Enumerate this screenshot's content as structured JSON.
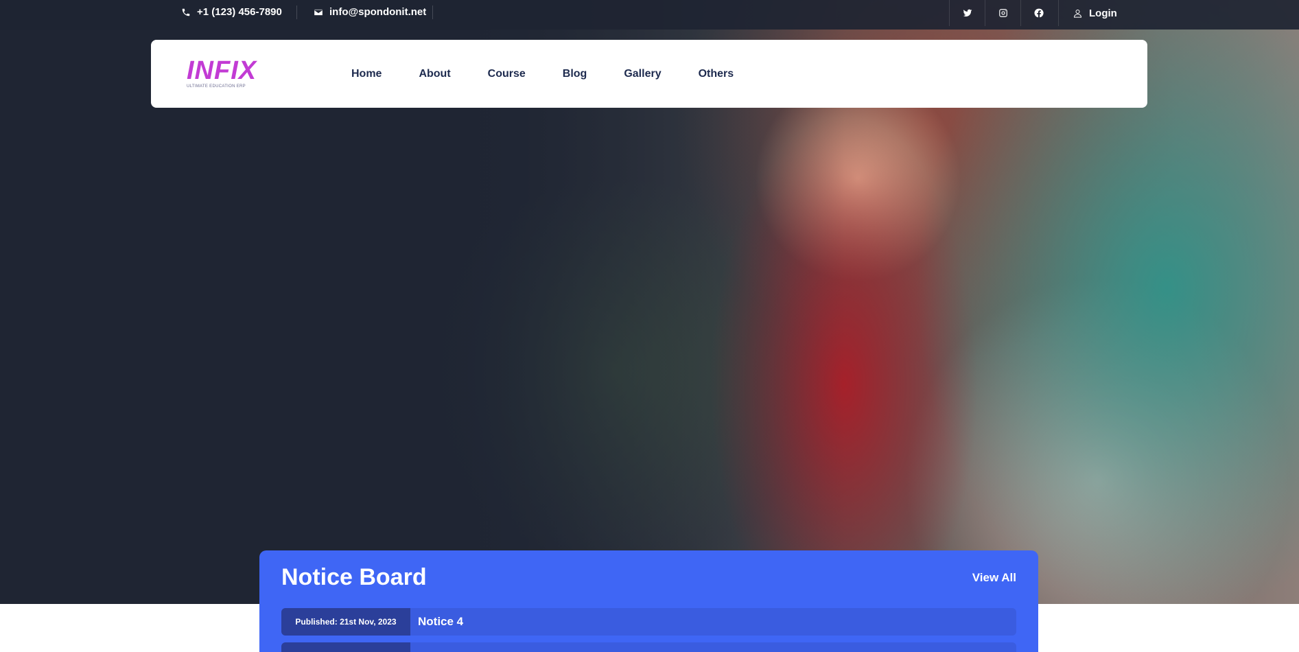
{
  "topbar": {
    "phone": "+1 (123) 456-7890",
    "email": "info@spondonit.net",
    "social": [
      "twitter-icon",
      "instagram-icon",
      "facebook-icon"
    ],
    "login_label": "Login"
  },
  "brand": {
    "logo_text": "INFIX",
    "tagline": "ULTIMATE EDUCATION ERP"
  },
  "nav": {
    "items": [
      {
        "label": "Home"
      },
      {
        "label": "About"
      },
      {
        "label": "Course"
      },
      {
        "label": "Blog"
      },
      {
        "label": "Gallery"
      },
      {
        "label": "Others"
      }
    ]
  },
  "notice_board": {
    "title": "Notice Board",
    "view_all_label": "View All",
    "notices": [
      {
        "published": "Published: 21st Nov, 2023",
        "title": "Notice 4"
      },
      {
        "published": "",
        "title": ""
      }
    ]
  },
  "colors": {
    "topbar_bg": "#1e2432",
    "nav_text": "#1d2a4e",
    "notice_bg": "#3f66f5",
    "notice_row": "#3a5ce0",
    "published_bg": "#2b3f9a"
  }
}
